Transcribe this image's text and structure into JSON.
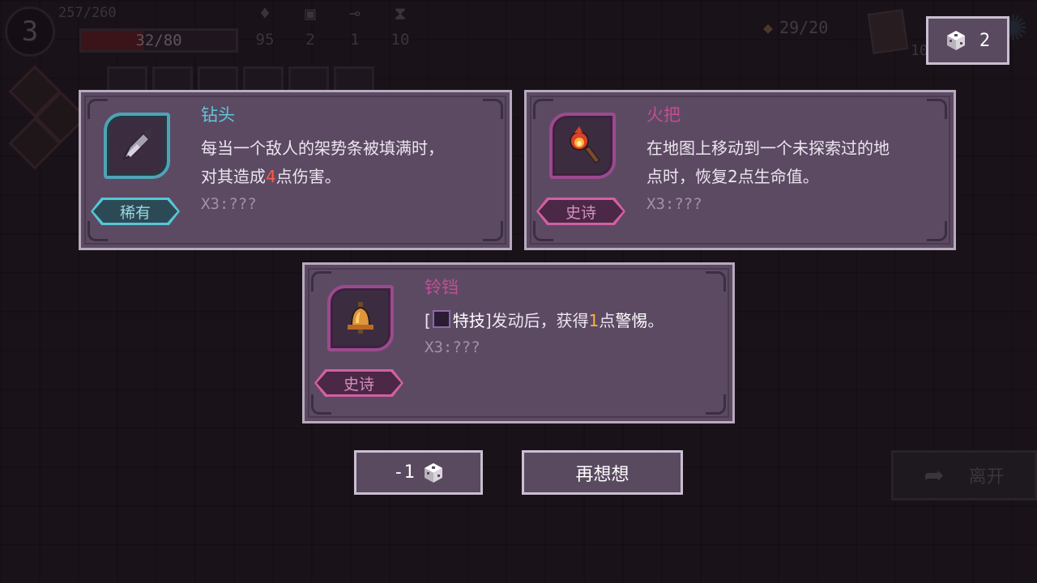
{
  "hud": {
    "level": "3",
    "xp": "257/260",
    "hp": "32/80",
    "hp_fraction": 0.4,
    "stats": [
      {
        "icon": "crystal-icon",
        "value": "95"
      },
      {
        "icon": "cube-icon",
        "value": "2"
      },
      {
        "icon": "key-icon",
        "value": "1"
      },
      {
        "icon": "hourglass-icon",
        "value": "10"
      }
    ],
    "energy": "29/20",
    "small_count": "10",
    "leave_label": "离开"
  },
  "cube_counter": {
    "icon": "cube-icon",
    "value": "2"
  },
  "cards": [
    {
      "name": "钻头",
      "rarity": "稀有",
      "desc_line1": "每当一个敌人的架势条被填满时，",
      "desc_line2_a": "对其造成",
      "desc_line2_num": "4",
      "desc_line2_b": "点伤害。",
      "x3": "X3:???",
      "icon": "drill-icon"
    },
    {
      "name": "火把",
      "rarity": "史诗",
      "desc_line1": "在地图上移动到一个未探索过的地",
      "desc_line2": "点时，恢复2点生命值。",
      "x3": "X3:???",
      "icon": "torch-icon"
    },
    {
      "name": "铃铛",
      "rarity": "史诗",
      "desc_a": "[",
      "desc_tag": "特技",
      "desc_b": "]发动后，获得",
      "desc_num": "1",
      "desc_c": "点",
      "desc_d": "警惕",
      "desc_e": "。",
      "x3": "X3:???",
      "icon": "bell-icon"
    }
  ],
  "buttons": {
    "reroll_cost": "-1",
    "reroll_icon": "cube-icon",
    "think_again": "再想想"
  },
  "colors": {
    "rare": "#5ec6d8",
    "epic": "#c24e94",
    "panel": "#5c4a63",
    "panel_border": "#b7aabd"
  }
}
